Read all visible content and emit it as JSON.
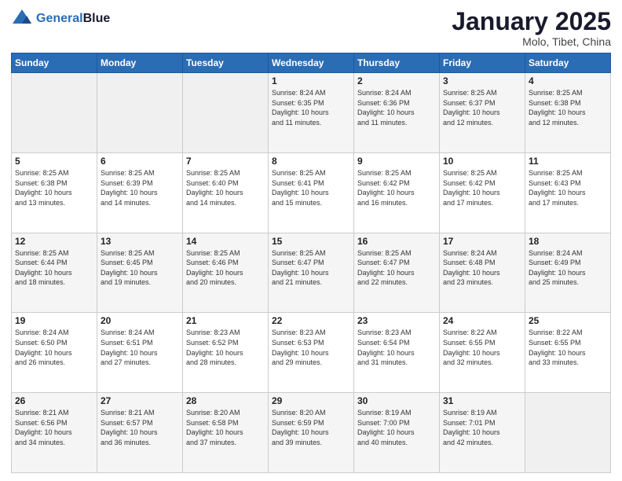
{
  "header": {
    "logo_line1": "General",
    "logo_line2": "Blue",
    "title": "January 2025",
    "subtitle": "Molo, Tibet, China"
  },
  "days_of_week": [
    "Sunday",
    "Monday",
    "Tuesday",
    "Wednesday",
    "Thursday",
    "Friday",
    "Saturday"
  ],
  "weeks": [
    [
      {
        "day": "",
        "info": ""
      },
      {
        "day": "",
        "info": ""
      },
      {
        "day": "",
        "info": ""
      },
      {
        "day": "1",
        "info": "Sunrise: 8:24 AM\nSunset: 6:35 PM\nDaylight: 10 hours\nand 11 minutes."
      },
      {
        "day": "2",
        "info": "Sunrise: 8:24 AM\nSunset: 6:36 PM\nDaylight: 10 hours\nand 11 minutes."
      },
      {
        "day": "3",
        "info": "Sunrise: 8:25 AM\nSunset: 6:37 PM\nDaylight: 10 hours\nand 12 minutes."
      },
      {
        "day": "4",
        "info": "Sunrise: 8:25 AM\nSunset: 6:38 PM\nDaylight: 10 hours\nand 12 minutes."
      }
    ],
    [
      {
        "day": "5",
        "info": "Sunrise: 8:25 AM\nSunset: 6:38 PM\nDaylight: 10 hours\nand 13 minutes."
      },
      {
        "day": "6",
        "info": "Sunrise: 8:25 AM\nSunset: 6:39 PM\nDaylight: 10 hours\nand 14 minutes."
      },
      {
        "day": "7",
        "info": "Sunrise: 8:25 AM\nSunset: 6:40 PM\nDaylight: 10 hours\nand 14 minutes."
      },
      {
        "day": "8",
        "info": "Sunrise: 8:25 AM\nSunset: 6:41 PM\nDaylight: 10 hours\nand 15 minutes."
      },
      {
        "day": "9",
        "info": "Sunrise: 8:25 AM\nSunset: 6:42 PM\nDaylight: 10 hours\nand 16 minutes."
      },
      {
        "day": "10",
        "info": "Sunrise: 8:25 AM\nSunset: 6:42 PM\nDaylight: 10 hours\nand 17 minutes."
      },
      {
        "day": "11",
        "info": "Sunrise: 8:25 AM\nSunset: 6:43 PM\nDaylight: 10 hours\nand 17 minutes."
      }
    ],
    [
      {
        "day": "12",
        "info": "Sunrise: 8:25 AM\nSunset: 6:44 PM\nDaylight: 10 hours\nand 18 minutes."
      },
      {
        "day": "13",
        "info": "Sunrise: 8:25 AM\nSunset: 6:45 PM\nDaylight: 10 hours\nand 19 minutes."
      },
      {
        "day": "14",
        "info": "Sunrise: 8:25 AM\nSunset: 6:46 PM\nDaylight: 10 hours\nand 20 minutes."
      },
      {
        "day": "15",
        "info": "Sunrise: 8:25 AM\nSunset: 6:47 PM\nDaylight: 10 hours\nand 21 minutes."
      },
      {
        "day": "16",
        "info": "Sunrise: 8:25 AM\nSunset: 6:47 PM\nDaylight: 10 hours\nand 22 minutes."
      },
      {
        "day": "17",
        "info": "Sunrise: 8:24 AM\nSunset: 6:48 PM\nDaylight: 10 hours\nand 23 minutes."
      },
      {
        "day": "18",
        "info": "Sunrise: 8:24 AM\nSunset: 6:49 PM\nDaylight: 10 hours\nand 25 minutes."
      }
    ],
    [
      {
        "day": "19",
        "info": "Sunrise: 8:24 AM\nSunset: 6:50 PM\nDaylight: 10 hours\nand 26 minutes."
      },
      {
        "day": "20",
        "info": "Sunrise: 8:24 AM\nSunset: 6:51 PM\nDaylight: 10 hours\nand 27 minutes."
      },
      {
        "day": "21",
        "info": "Sunrise: 8:23 AM\nSunset: 6:52 PM\nDaylight: 10 hours\nand 28 minutes."
      },
      {
        "day": "22",
        "info": "Sunrise: 8:23 AM\nSunset: 6:53 PM\nDaylight: 10 hours\nand 29 minutes."
      },
      {
        "day": "23",
        "info": "Sunrise: 8:23 AM\nSunset: 6:54 PM\nDaylight: 10 hours\nand 31 minutes."
      },
      {
        "day": "24",
        "info": "Sunrise: 8:22 AM\nSunset: 6:55 PM\nDaylight: 10 hours\nand 32 minutes."
      },
      {
        "day": "25",
        "info": "Sunrise: 8:22 AM\nSunset: 6:55 PM\nDaylight: 10 hours\nand 33 minutes."
      }
    ],
    [
      {
        "day": "26",
        "info": "Sunrise: 8:21 AM\nSunset: 6:56 PM\nDaylight: 10 hours\nand 34 minutes."
      },
      {
        "day": "27",
        "info": "Sunrise: 8:21 AM\nSunset: 6:57 PM\nDaylight: 10 hours\nand 36 minutes."
      },
      {
        "day": "28",
        "info": "Sunrise: 8:20 AM\nSunset: 6:58 PM\nDaylight: 10 hours\nand 37 minutes."
      },
      {
        "day": "29",
        "info": "Sunrise: 8:20 AM\nSunset: 6:59 PM\nDaylight: 10 hours\nand 39 minutes."
      },
      {
        "day": "30",
        "info": "Sunrise: 8:19 AM\nSunset: 7:00 PM\nDaylight: 10 hours\nand 40 minutes."
      },
      {
        "day": "31",
        "info": "Sunrise: 8:19 AM\nSunset: 7:01 PM\nDaylight: 10 hours\nand 42 minutes."
      },
      {
        "day": "",
        "info": ""
      }
    ]
  ]
}
